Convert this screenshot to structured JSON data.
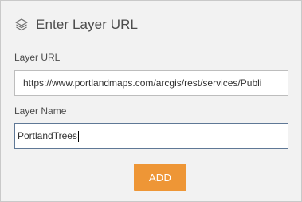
{
  "header": {
    "icon": "layers-icon",
    "title": "Enter Layer URL"
  },
  "form": {
    "url_label": "Layer URL",
    "url_value": "https://www.portlandmaps.com/arcgis/rest/services/Publi",
    "name_label": "Layer Name",
    "name_value": "PortlandTrees"
  },
  "actions": {
    "add_label": "ADD",
    "add_color": "#ee9636"
  }
}
